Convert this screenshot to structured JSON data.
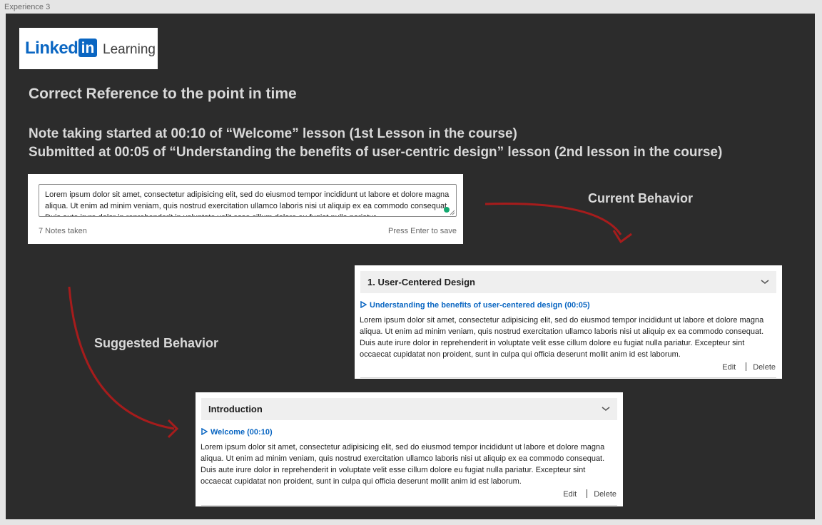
{
  "frame_label": "Experience 3",
  "logo": {
    "wordmark": "Linked",
    "badge": "in",
    "product": "Learning",
    "brand_color": "#0a66c2"
  },
  "headings": {
    "title": "Correct Reference to the point in time",
    "line1": "Note taking started at 00:10 of “Welcome” lesson (1st Lesson in the course)",
    "line2": "Submitted at 00:05 of “Understanding the benefits of user-centric design” lesson (2nd lesson in the course)"
  },
  "note_input": {
    "text": "Lorem ipsum dolor sit amet, consectetur adipisicing elit, sed do eiusmod tempor incididunt ut labore et dolore magna aliqua. Ut enim ad minim veniam, quis nostrud exercitation ullamco laboris nisi ut aliquip ex ea commodo consequat. Duis aute irure dolor in reprehenderit in voluptate velit esse cillum dolore eu fugiat nulla pariatur.",
    "notes_count": "7 Notes taken",
    "save_hint": "Press Enter to save",
    "status_color": "#13a86f"
  },
  "labels": {
    "current": "Current Behavior",
    "suggested": "Suggested Behavior",
    "arrow_color": "#a61c1c"
  },
  "current_card": {
    "section": "1. User-Centered Design",
    "link": "Understanding the benefits of user-centered design (00:05)",
    "body": "Lorem ipsum dolor sit amet, consectetur adipisicing elit, sed do eiusmod tempor incididunt ut labore et dolore magna aliqua. Ut enim ad minim veniam, quis nostrud exercitation ullamco laboris nisi ut aliquip ex ea commodo consequat. Duis aute irure dolor in reprehenderit in voluptate velit esse cillum dolore eu fugiat nulla pariatur. Excepteur sint occaecat cupidatat non proident, sunt in culpa qui officia deserunt mollit anim id est laborum.",
    "edit": "Edit",
    "delete": "Delete"
  },
  "suggested_card": {
    "section": "Introduction",
    "link": "Welcome (00:10)",
    "body": "Lorem ipsum dolor sit amet, consectetur adipisicing elit, sed do eiusmod tempor incididunt ut labore et dolore magna aliqua. Ut enim ad minim veniam, quis nostrud exercitation ullamco laboris nisi ut aliquip ex ea commodo consequat. Duis aute irure dolor in reprehenderit in voluptate velit esse cillum dolore eu fugiat nulla pariatur. Excepteur sint occaecat cupidatat non proident, sunt in culpa qui officia deserunt mollit anim id est laborum.",
    "edit": "Edit",
    "delete": "Delete"
  }
}
